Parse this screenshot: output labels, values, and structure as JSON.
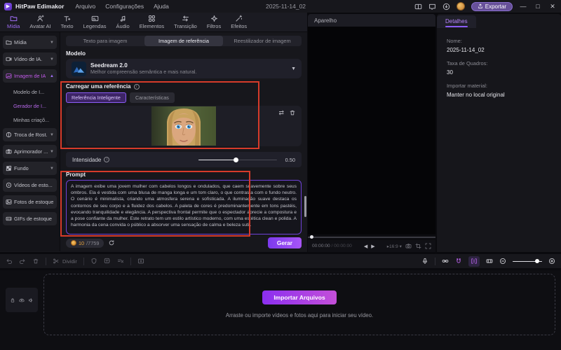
{
  "app": {
    "name": "HitPaw Edimakor",
    "date": "2025-11-14_02"
  },
  "titlebar": {
    "menus": [
      "Arquivo",
      "Configurações",
      "Ajuda"
    ],
    "export_label": "Exportar",
    "icons": [
      "layout-icon",
      "feedback-icon",
      "download-icon",
      "avatar",
      "minimize-icon",
      "maximize-icon",
      "close-icon"
    ]
  },
  "ribbon": {
    "active": "Mídia",
    "items": [
      {
        "label": "Mídia",
        "icon": "media-icon"
      },
      {
        "label": "Avatar AI",
        "icon": "avatar-ai-icon"
      },
      {
        "label": "Texto",
        "icon": "text-icon"
      },
      {
        "label": "Legendas",
        "icon": "subtitles-icon"
      },
      {
        "label": "Áudio",
        "icon": "audio-icon"
      },
      {
        "label": "Elementos",
        "icon": "elements-icon"
      },
      {
        "label": "Transição",
        "icon": "transition-icon"
      },
      {
        "label": "Filtros",
        "icon": "filters-icon"
      },
      {
        "label": "Efeitos",
        "icon": "effects-icon"
      }
    ]
  },
  "sidebar": {
    "items": [
      {
        "label": "Mídia",
        "icon": "folder-icon",
        "chevron": "down"
      },
      {
        "label": "Vídeo de IA.",
        "icon": "ai-video-icon",
        "chevron": "down"
      },
      {
        "label": "Imagem de IA",
        "icon": "ai-image-icon",
        "chevron": "up",
        "active": true
      },
      {
        "label": "Modelo de I...",
        "type": "sub"
      },
      {
        "label": "Gerador de I...",
        "type": "sub",
        "active": true
      },
      {
        "label": "Minhas criaçõ...",
        "type": "sub"
      },
      {
        "label": "Troca de Rost...",
        "icon": "face-swap-icon",
        "chevron": "down"
      },
      {
        "label": "Aprimorador ...",
        "icon": "enhancer-icon",
        "chevron": "down"
      },
      {
        "label": "Fundo",
        "icon": "background-icon",
        "chevron": "down"
      },
      {
        "label": "Vídeos de esto...",
        "icon": "stock-video-icon"
      },
      {
        "label": "Fotos de estoque",
        "icon": "stock-photo-icon"
      },
      {
        "label": "GIFs de estoque",
        "icon": "stock-gif-icon"
      }
    ]
  },
  "generator": {
    "tabs": [
      "Texto para imagem",
      "Imagem de referência",
      "Reestilizador de imagem"
    ],
    "active_tab": "Imagem de referência",
    "model_section": "Modelo",
    "model_name": "Seedream 2.0",
    "model_desc": "Melhor compreensão semântica e mais natural.",
    "reference_label": "Carregar uma referência",
    "reference_tabs": [
      "Referência Inteligente",
      "Características"
    ],
    "reference_active_tab": "Referência Inteligente",
    "intensity_label": "Intensidade",
    "intensity_value": "0.50",
    "prompt_label": "Prompt",
    "prompt_text": "A imagem exibe uma jovem mulher com cabelos longos e ondulados, que caem suavemente sobre seus ombros. Ela é vestida com uma blusa de manga longa e um tom claro, o que contrasta com o fundo neutro. O cenário é minimalista, criando uma atmosfera serena e sofisticada. A iluminação suave destaca os contornos de seu corpo e a fluidez dos cabelos. A paleta de cores é predominantemente em tons pastéis, evocando tranquilidade e elegância. A perspectiva frontal permite que o espectador aprecie a compostura e a pose confiante da mulher. Este retrato tem um estilo artístico moderno, com uma estética clean e polida. A harmonia da cena convida o público a absorver uma sensação de calma e beleza sutil.",
    "counter_used": "10",
    "counter_total": "/7759",
    "generate_label": "Gerar"
  },
  "preview": {
    "header": "Aparelho",
    "time_current": "00:00:00",
    "time_separator": " / ",
    "time_total": "00:00:00",
    "aspect_ratio": "16:9"
  },
  "details": {
    "tab": "Detalhes",
    "fields": [
      {
        "label": "Nome:",
        "value": "2025-11-14_02"
      },
      {
        "label": "Taxa de Quadros:",
        "value": "30"
      },
      {
        "label": "Importar material:",
        "value": "Manter no local original"
      }
    ]
  },
  "timeline": {
    "divide_label": "Dividir",
    "import_button": "Importar Arquivos",
    "import_hint": "Arraste ou importe vídeos e fotos aqui para iniciar seu vídeo."
  },
  "colors": {
    "accent_purple": "#8b5cf6",
    "active_magenta": "#c05ae8",
    "annotation_red": "#d63b2a",
    "export_button": "#675099",
    "counter_gold": "#e8a33d",
    "generate_gradient_start": "#7c3aed",
    "generate_gradient_end": "#a855f7"
  }
}
